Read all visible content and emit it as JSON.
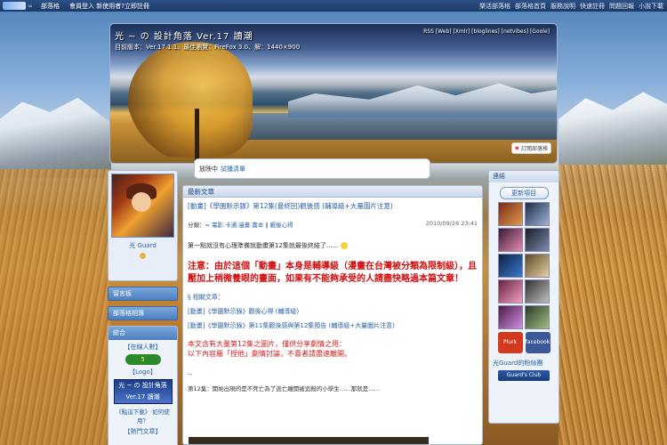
{
  "topbar": {
    "logo_dots": "∞",
    "brand": "部落格",
    "login_text": "會員登入  新使用者?立即註冊",
    "links": [
      "樂活部落格",
      "部落格首頁",
      "服務說明",
      "快速註冊",
      "問題回報",
      "小說下載"
    ]
  },
  "header": {
    "title": "光 ~ の 設計角落    Ver.17 讀潮",
    "version": "目前版本：Ver.17.1.1、最佳瀏覽：FireFox 3.0、解：1440×900",
    "rss": "RSS [Web] [Xmlr] [bloglines] [netvibes] [Goole]",
    "subscribe": "訂閱部落格"
  },
  "nowplaying": {
    "label": "放映中",
    "link": "試播清單"
  },
  "left": {
    "username": "光 Guard",
    "menu1": "留言板",
    "menu2": "部落格相簿",
    "composite_title": "綜合",
    "online_label": "【在線人數】",
    "online_count": "5",
    "logo_label": "【Logo】",
    "logo_banner_line1": "光 ~ の 設計角落",
    "logo_banner_line2": "Ver.17 讀潮",
    "how_text": "《點這下載》 如何使用？",
    "hot_label": "【熱門文章】"
  },
  "main": {
    "heading": "最新文章",
    "post_title": "[動畫]《學園默示錄》第12集(最終回)觀後感 (輔導級+大量圖片注意)",
    "category_label": "分類：",
    "categories": "= 電影.卡通.漫畫.書本 ‖ 觀後心得",
    "date": "2010/09/26 23:41",
    "intro": "第一點就沒有心理準備就動畫第12集就最後終結了......",
    "warning": "注意：由於這個「動畫」本身是輔導級（漫畫在台灣被分類為限制級），且壓加上稍微養眼的畫面，如果有不能夠承受的人請盡快略過本篇文章！",
    "related_heading": "§ 相關文章：",
    "related": [
      "[動畫]《學園默示錄》觀後心得 (輔導級)",
      "[動畫]《學園默示錄》第11集觀後感與第12集預告 (輔導級+大量圖片注意)"
    ],
    "notice_line1": "本文含有大量第12集之圖片，僅供分享劇情之用：",
    "notice_line2": "以下內容屬「捏他」劇情討論，不喜者請盡速離開。",
    "dash": "--",
    "chapter": "第12集：開始出現的是不死亡為了逃亡離開被追殺的小學生……那就是……"
  },
  "right": {
    "heading": "連結",
    "update_button": "更新項目",
    "fb_labels": [
      "Plurk",
      "facebook"
    ],
    "fans_label": "光Guard的粉絲團",
    "club_label": "Guard's Club"
  },
  "colors": {
    "accent": "#2b62a8",
    "warning_red": "#d01010",
    "header_bar": "#4d7fbd"
  }
}
